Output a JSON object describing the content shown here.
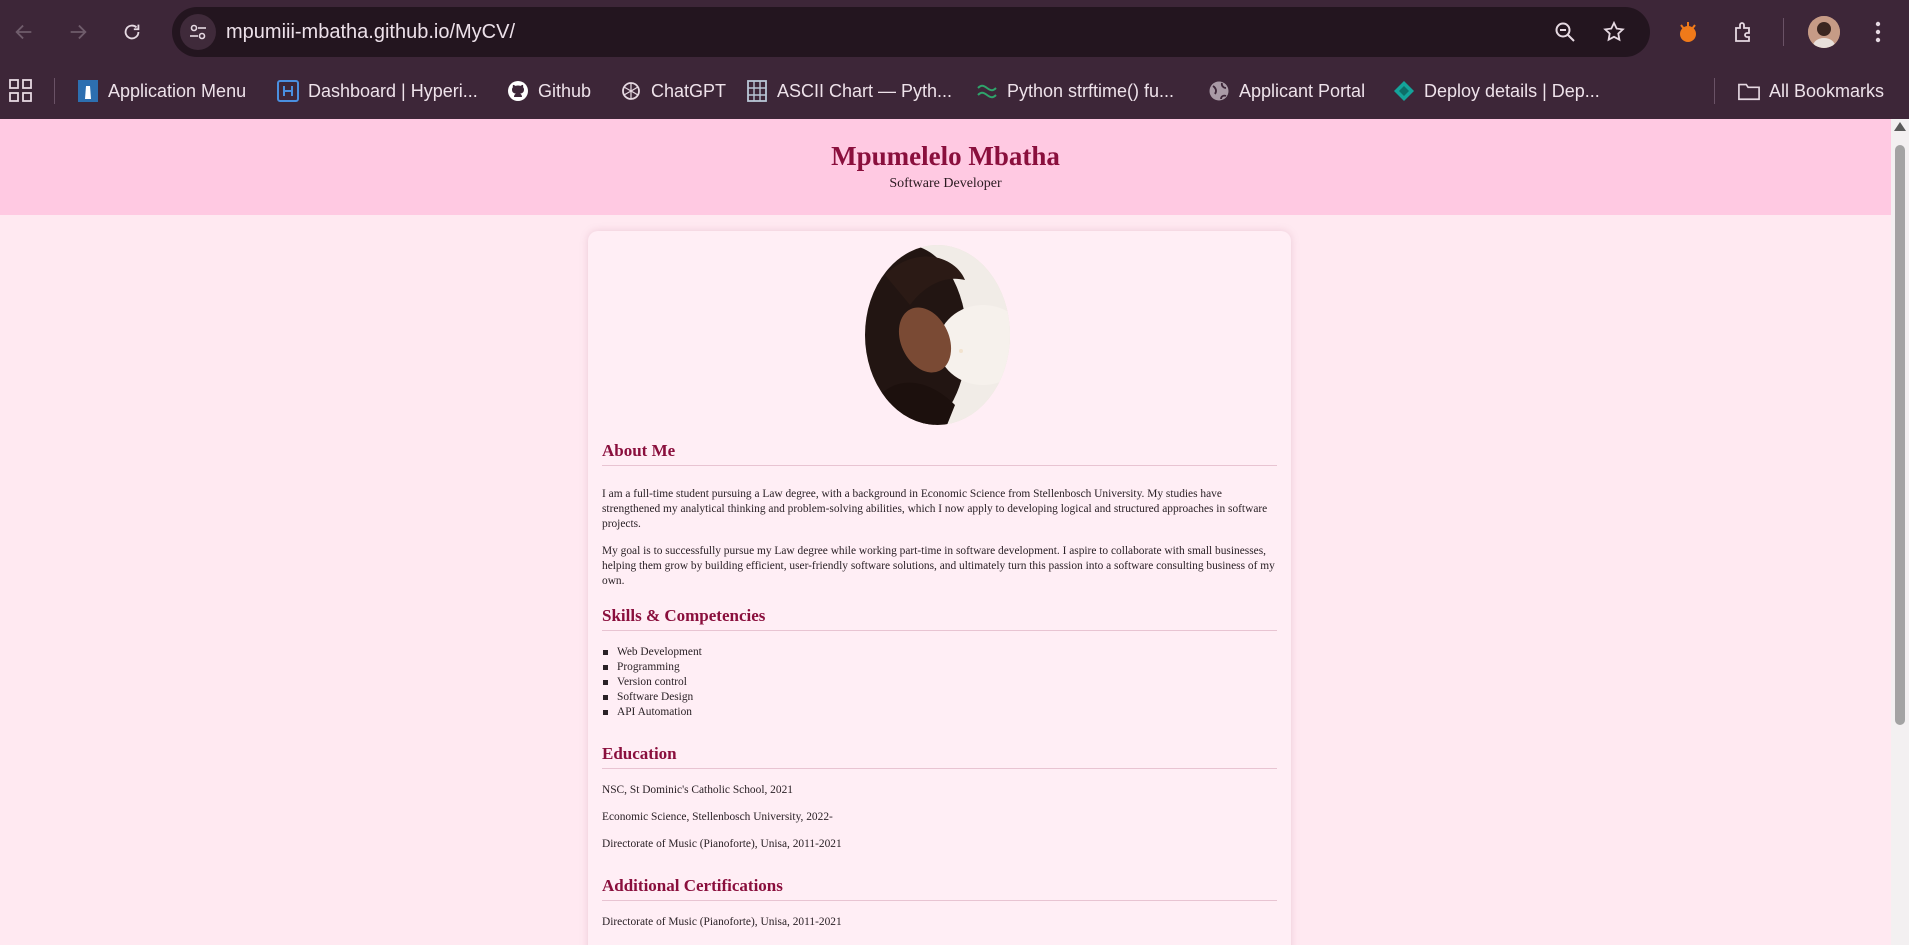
{
  "browser": {
    "url": "mpumiii-mbatha.github.io/MyCV/",
    "bookmarks": [
      {
        "label": "Application Menu",
        "icon": "lighthouse-icon"
      },
      {
        "label": "Dashboard | Hyperi...",
        "icon": "hyperion-icon"
      },
      {
        "label": "Github",
        "icon": "github-icon"
      },
      {
        "label": "ChatGPT",
        "icon": "chatgpt-icon"
      },
      {
        "label": "ASCII Chart — Pyth...",
        "icon": "ascii-chart-icon"
      },
      {
        "label": "Python strftime() fu...",
        "icon": "python-icon"
      },
      {
        "label": "Applicant Portal",
        "icon": "globe-icon"
      },
      {
        "label": "Deploy details | Dep...",
        "icon": "deploy-icon"
      }
    ],
    "all_bookmarks": "All Bookmarks",
    "colors": {
      "chrome": "#3d2638",
      "omnibox": "#23151f",
      "text": "#ece0e9"
    }
  },
  "page": {
    "name": "Mpumelelo Mbatha",
    "role": "Software Developer",
    "about": {
      "title": "About Me",
      "paragraphs": [
        "I am a full-time student pursuing a Law degree, with a background in Economic Science from Stellenbosch University. My studies have strengthened my analytical thinking and problem-solving abilities, which I now apply to developing logical and structured approaches in software projects.",
        "My goal is to successfully pursue my Law degree while working part-time in software development. I aspire to collaborate with small businesses, helping them grow by building efficient, user-friendly software solutions, and ultimately turn this passion into a software consulting business of my own."
      ]
    },
    "skills": {
      "title": "Skills & Competencies",
      "items": [
        "Web Development",
        "Programming",
        "Version control",
        "Software Design",
        "API Automation"
      ]
    },
    "education": {
      "title": "Education",
      "items": [
        "NSC, St Dominic's Catholic School, 2021",
        "Economic Science, Stellenbosch University, 2022-",
        "Directorate of Music (Pianoforte), Unisa, 2011-2021"
      ]
    },
    "certifications": {
      "title": "Additional Certifications",
      "items": [
        "Directorate of Music (Pianoforte), Unisa, 2011-2021"
      ]
    },
    "colors": {
      "header_bg": "#ffc9e2",
      "page_bg": "#ffe9f1",
      "accent": "#8a0f3d"
    }
  }
}
